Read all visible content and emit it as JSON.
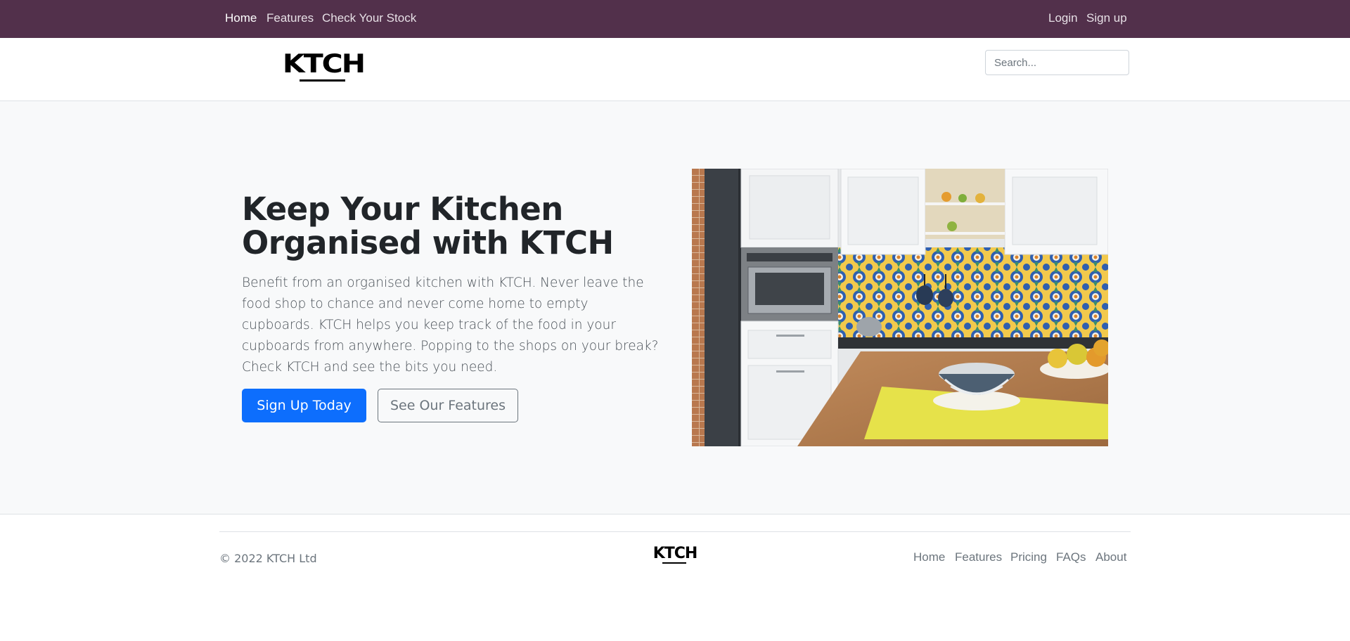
{
  "topnav": {
    "links": [
      "Home",
      "Features",
      "Check Your Stock"
    ],
    "auth": [
      "Login",
      "Sign up"
    ]
  },
  "header": {
    "logo_text": "KTCH",
    "search_placeholder": "Search..."
  },
  "hero": {
    "title": "Keep Your Kitchen Organised with KTCH",
    "description": "Benefit from an organised kitchen with KTCH. Never leave the food shop to chance and never come home to empty cupboards. KTCH helps you keep track of the food in your cupboards from anywhere. Popping to the shops on your break? Check KTCH and see the bits you need.",
    "primary_button": "Sign Up Today",
    "secondary_button": "See Our Features"
  },
  "footer": {
    "copyright": "© 2022 KTCH Ltd",
    "logo_text": "KTCH",
    "links": [
      "Home",
      "Features",
      "Pricing",
      "FAQs",
      "About"
    ]
  },
  "colors": {
    "nav_bg": "#52304b",
    "primary": "#0d6efd",
    "hero_bg": "#f8f9fa"
  }
}
